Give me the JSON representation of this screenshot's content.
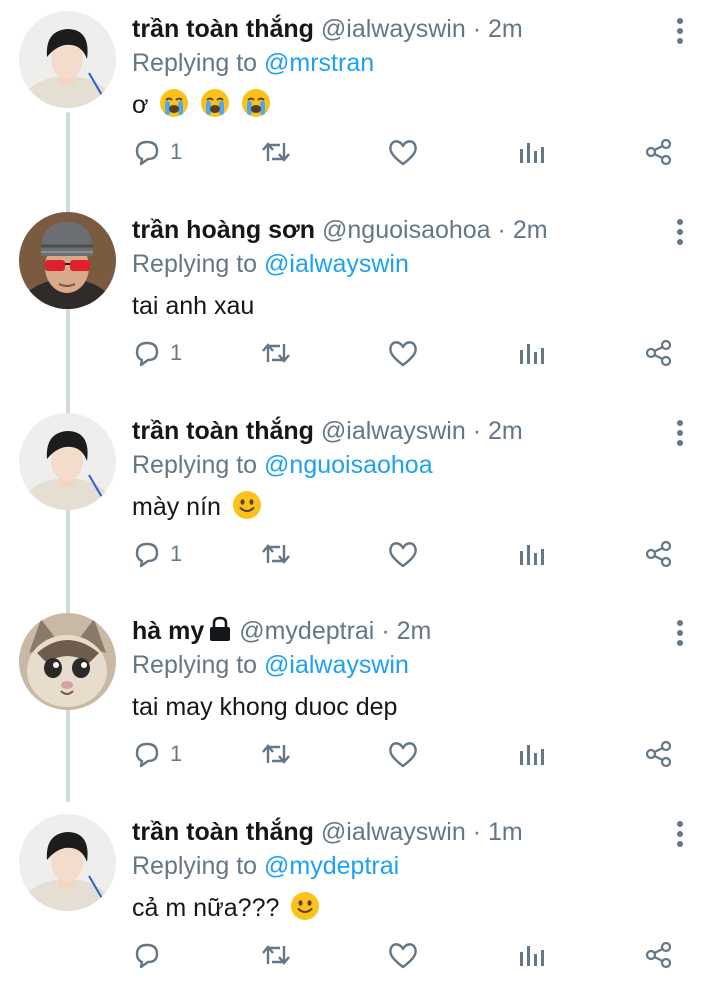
{
  "colors": {
    "accent": "#1da1f2",
    "muted": "#657786",
    "text": "#14171a",
    "thread_line": "#cfd9de"
  },
  "icons": {
    "reply": "reply-icon",
    "retweet": "retweet-icon",
    "like": "heart-icon",
    "stats": "stats-icon",
    "share": "share-icon",
    "more": "more-vertical-icon",
    "lock": "lock-icon"
  },
  "tweets": [
    {
      "name": "trần toàn thắng",
      "handle": "@ialwayswin",
      "dot": "·",
      "time": "2m",
      "reply_prefix": "Replying to",
      "reply_to": "@mrstran",
      "text": "ơ",
      "emoji": [
        "loudly-crying-face",
        "loudly-crying-face",
        "loudly-crying-face"
      ],
      "reply_count": "1"
    },
    {
      "name": "trần hoàng sơn",
      "handle": "@nguoisaohoa",
      "dot": "·",
      "time": "2m",
      "reply_prefix": "Replying to",
      "reply_to": "@ialwayswin",
      "text": "tai anh xau",
      "emoji": [],
      "reply_count": "1"
    },
    {
      "name": "trần toàn thắng",
      "handle": "@ialwayswin",
      "dot": "·",
      "time": "2m",
      "reply_prefix": "Replying to",
      "reply_to": "@nguoisaohoa",
      "text": "mày nín",
      "emoji": [
        "slightly-smiling-face"
      ],
      "reply_count": "1"
    },
    {
      "name": "hà my",
      "handle": "@mydeptrai",
      "dot": "·",
      "time": "2m",
      "reply_prefix": "Replying to",
      "reply_to": "@ialwayswin",
      "text": "tai may khong duoc dep",
      "emoji": [],
      "reply_count": "1",
      "locked": true
    },
    {
      "name": "trần toàn thắng",
      "handle": "@ialwayswin",
      "dot": "·",
      "time": "1m",
      "reply_prefix": "Replying to",
      "reply_to": "@mydeptrai",
      "text": "cả m nữa???",
      "emoji": [
        "slightly-smiling-face"
      ],
      "reply_count": ""
    }
  ]
}
